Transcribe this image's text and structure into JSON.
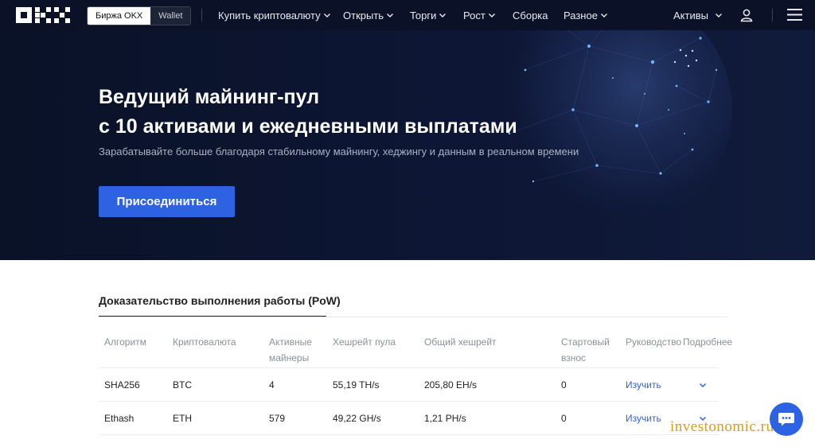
{
  "header": {
    "switch": {
      "exchange": "Биржа OKX",
      "wallet": "Wallet"
    },
    "nav": [
      {
        "label": "Купить криптовалюту",
        "dropdown": true
      },
      {
        "label": "Открыть",
        "dropdown": true
      },
      {
        "label": "Торги",
        "dropdown": true
      },
      {
        "label": "Рост",
        "dropdown": true
      },
      {
        "label": "Сборка",
        "dropdown": false
      },
      {
        "label": "Разное",
        "dropdown": true
      }
    ],
    "assets": "Активы"
  },
  "hero": {
    "title_line1": "Ведущий майнинг-пул",
    "title_line2": "с 10 активами и ежедневными выплатами",
    "subtitle": "Зарабатывайте больше благодаря стабильному майнингу, хеджингу и данным в реальном времени",
    "cta": "Присоединиться"
  },
  "section": {
    "tab": "Доказательство выполнения работы (PoW)",
    "columns": [
      "Алгоритм",
      "Криптовалюта",
      "Активные майнеры",
      "Хешрейт пула",
      "Общий хешрейт",
      "Стартовый взнос",
      "Руководство",
      "Подробнее"
    ],
    "rows": [
      {
        "algo": "SHA256",
        "coin": "BTC",
        "miners": "4",
        "pool": "55,19 TH/s",
        "total": "205,80 EH/s",
        "fee": "0",
        "guide": "Изучить"
      },
      {
        "algo": "Ethash",
        "coin": "ETH",
        "miners": "579",
        "pool": "49,22 GH/s",
        "total": "1,21 PH/s",
        "fee": "0",
        "guide": "Изучить"
      }
    ]
  },
  "watermark": "investonomic.ru",
  "colors": {
    "accent": "#2d63e2",
    "hero_bg": "#0c1430",
    "header_bg": "#0b1228"
  }
}
